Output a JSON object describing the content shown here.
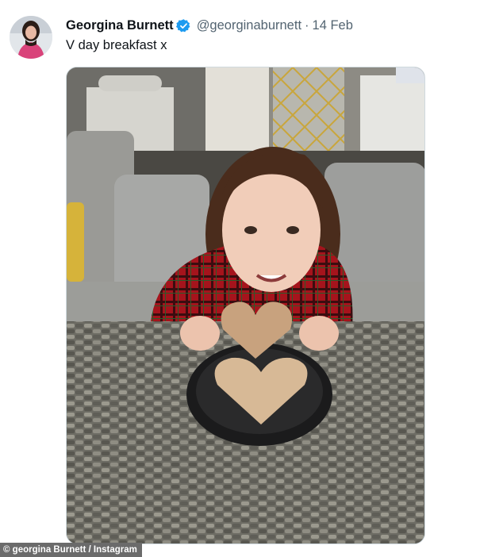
{
  "tweet": {
    "author_name": "Georgina Burnett",
    "handle": "@georginaburnett",
    "separator": "·",
    "date": "14 Feb",
    "text": "V day breakfast x",
    "verified": true,
    "verified_color": "#1d9bf0"
  },
  "photo_credit": "© georgina Burnett / Instagram",
  "icons": {
    "verified": "verified-badge-icon"
  }
}
